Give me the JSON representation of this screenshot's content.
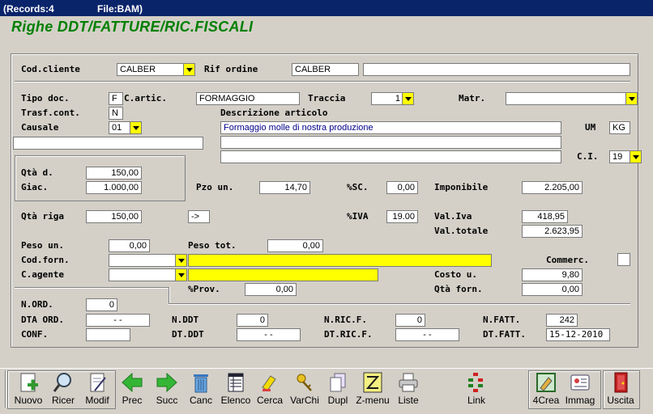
{
  "window": {
    "records": "(Records:4",
    "file": "File:BAM)",
    "title": "Righe DDT/FATTURE/RIC.FISCALI"
  },
  "fields": {
    "cod_cliente": {
      "label": "Cod.cliente",
      "value": "CALBER"
    },
    "rif_ordine": {
      "label": "Rif ordine",
      "value": "CALBER",
      "extra": ""
    },
    "tipo_doc": {
      "label": "Tipo doc.",
      "value": "F"
    },
    "c_artic": {
      "label": "C.artic.",
      "value": "FORMAGGIO"
    },
    "traccia": {
      "label": "Traccia",
      "value": "1"
    },
    "matr": {
      "label": "Matr.",
      "value": ""
    },
    "trasf_cont": {
      "label": "Trasf.cont.",
      "value": "N"
    },
    "descrizione": {
      "label": "Descrizione articolo",
      "value": "Formaggio molle di nostra produzione",
      "line2": "",
      "line3": ""
    },
    "causale": {
      "label": "Causale",
      "value": "01",
      "extra": ""
    },
    "um": {
      "label": "UM",
      "value": "KG"
    },
    "ci": {
      "label": "C.I.",
      "value": "19"
    },
    "qta_d": {
      "label": "Qtà d.",
      "value": "150,00"
    },
    "giac": {
      "label": "Giac.",
      "value": "1.000,00"
    },
    "pzo_un": {
      "label": "Pzo un.",
      "value": "14,70"
    },
    "sc": {
      "label": "%SC.",
      "value": "0,00"
    },
    "imponibile": {
      "label": "Imponibile",
      "value": "2.205,00"
    },
    "qta_riga": {
      "label": "Qtà riga",
      "value": "150,00"
    },
    "arrow": {
      "value": "->"
    },
    "iva": {
      "label": "%IVA",
      "value": "19.00"
    },
    "val_iva": {
      "label": "Val.Iva",
      "value": "418,95"
    },
    "val_totale": {
      "label": "Val.totale",
      "value": "2.623,95"
    },
    "peso_un": {
      "label": "Peso un.",
      "value": "0,00"
    },
    "peso_tot": {
      "label": "Peso tot.",
      "value": "0,00"
    },
    "cod_forn": {
      "label": "Cod.forn.",
      "value": "",
      "desc": ""
    },
    "commerc": {
      "label": "Commerc."
    },
    "c_agente": {
      "label": "C.agente",
      "value": "",
      "desc": ""
    },
    "costo_u": {
      "label": "Costo u.",
      "value": "9,80"
    },
    "prov": {
      "label": "%Prov.",
      "value": "0,00"
    },
    "qta_forn": {
      "label": "Qtà forn.",
      "value": "0,00"
    },
    "n_ord": {
      "label": "N.ORD.",
      "value": "0"
    },
    "dta_ord": {
      "label": "DTA ORD.",
      "value": "-   -"
    },
    "n_ddt": {
      "label": "N.DDT",
      "value": "0"
    },
    "n_ric_f": {
      "label": "N.RIC.F.",
      "value": "0"
    },
    "n_fatt": {
      "label": "N.FATT.",
      "value": "242"
    },
    "conf": {
      "label": "CONF.",
      "value": ""
    },
    "dt_ddt": {
      "label": "DT.DDT",
      "value": "-   -"
    },
    "dt_ric_f": {
      "label": "DT.RIC.F.",
      "value": "-   -"
    },
    "dt_fatt": {
      "label": "DT.FATT.",
      "value": "15-12-2010"
    }
  },
  "toolbar": [
    {
      "label": "Nuovo",
      "icon": "new-document-icon"
    },
    {
      "label": "Ricer",
      "icon": "magnifier-icon"
    },
    {
      "label": "Modif",
      "icon": "edit-document-icon"
    },
    {
      "label": "Prec",
      "icon": "arrow-left-icon"
    },
    {
      "label": "Succ",
      "icon": "arrow-right-icon"
    },
    {
      "label": "Canc",
      "icon": "trash-icon"
    },
    {
      "label": "Elenco",
      "icon": "list-icon"
    },
    {
      "label": "Cerca",
      "icon": "highlighter-icon"
    },
    {
      "label": "VarChi",
      "icon": "keys-icon"
    },
    {
      "label": "Dupl",
      "icon": "duplicate-icon"
    },
    {
      "label": "Z-menu",
      "icon": "z-menu-icon"
    },
    {
      "label": "Liste",
      "icon": "printer-icon"
    },
    {
      "label": "Link",
      "icon": "link-tree-icon"
    },
    {
      "label": "4Crea",
      "icon": "create-frame-icon"
    },
    {
      "label": "Immag",
      "icon": "image-card-icon"
    },
    {
      "label": "Uscita",
      "icon": "exit-door-icon"
    }
  ],
  "colors": {
    "title_green": "#008000",
    "highlight_yellow": "#ffff00",
    "titlebar_blue": "#0a246a"
  }
}
